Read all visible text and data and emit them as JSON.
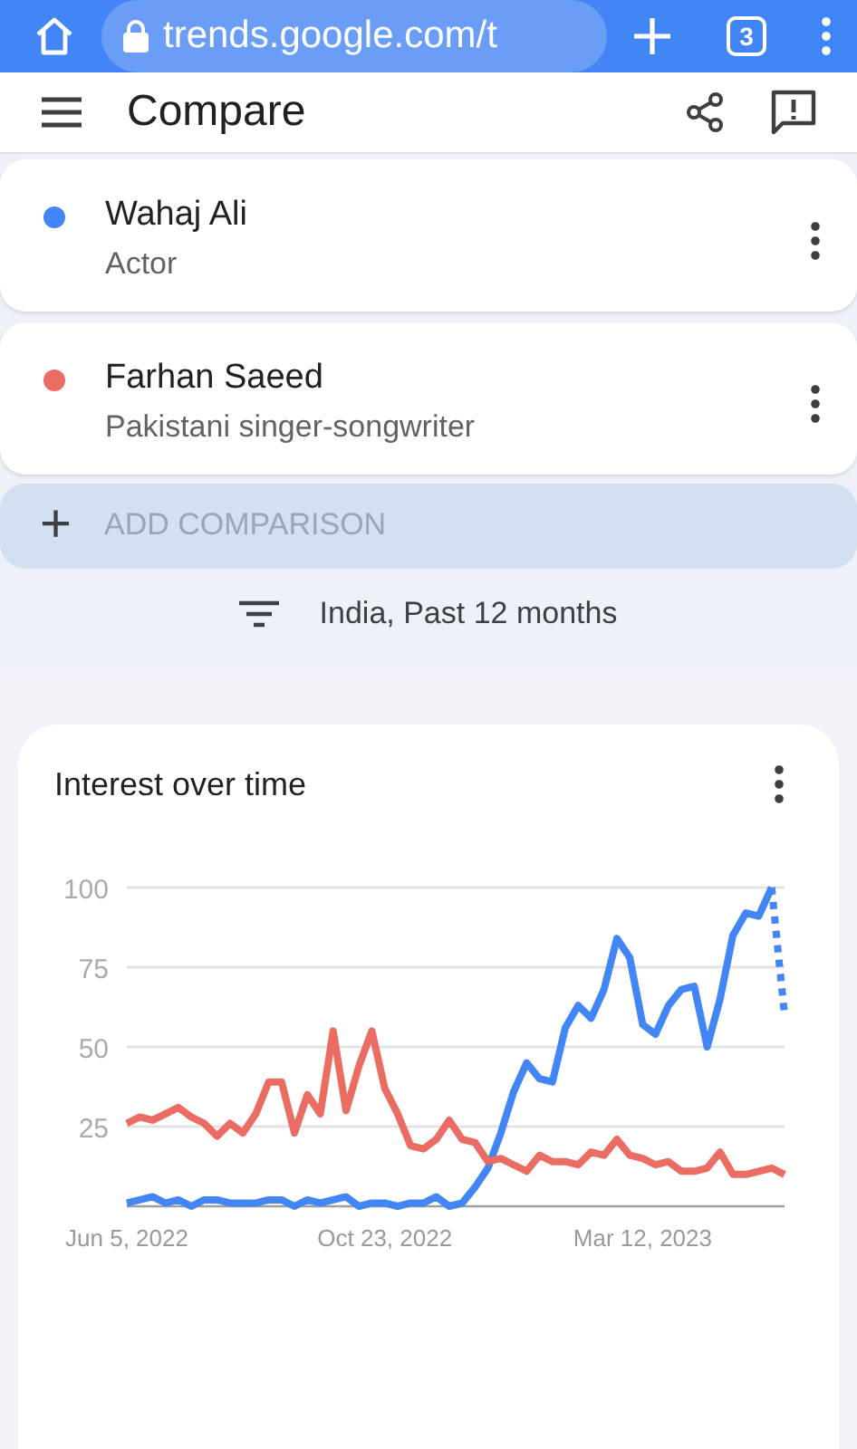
{
  "browser": {
    "url": "trends.google.com/t",
    "tab_count": "3"
  },
  "header": {
    "title": "Compare"
  },
  "terms": [
    {
      "name": "Wahaj Ali",
      "description": "Actor",
      "color": "#4285f4"
    },
    {
      "name": "Farhan Saeed",
      "description": "Pakistani singer-songwriter",
      "color": "#ea6c62"
    }
  ],
  "add_comparison": {
    "icon": "+",
    "label": "ADD COMPARISON"
  },
  "filter": {
    "label": "India, Past 12 months"
  },
  "interest_card": {
    "title": "Interest over time",
    "chart_data": {
      "type": "line",
      "categories": [
        "Jun 5, 2022",
        null,
        null,
        null,
        null,
        null,
        null,
        null,
        null,
        null,
        null,
        null,
        null,
        null,
        null,
        null,
        null,
        null,
        null,
        null,
        "Oct 23, 2022",
        null,
        null,
        null,
        null,
        null,
        null,
        null,
        null,
        null,
        null,
        null,
        null,
        null,
        null,
        null,
        null,
        null,
        null,
        null,
        "Mar 12, 2023",
        null,
        null,
        null,
        null,
        null,
        null,
        null,
        null,
        null,
        null,
        null
      ],
      "series": [
        {
          "color": "#4285f4",
          "values": [
            1,
            2,
            3,
            1,
            2,
            0,
            2,
            2,
            1,
            1,
            1,
            2,
            2,
            0,
            2,
            1,
            2,
            3,
            0,
            1,
            1,
            0,
            1,
            1,
            3,
            0,
            1,
            6,
            12,
            23,
            36,
            45,
            40,
            39,
            56,
            63,
            59,
            68,
            84,
            78,
            57,
            54,
            63,
            68,
            69,
            50,
            65,
            85,
            92,
            91,
            100,
            null
          ]
        },
        {
          "color": "#4285f4",
          "line_style": "dotted",
          "values": [
            null,
            null,
            null,
            null,
            null,
            null,
            null,
            null,
            null,
            null,
            null,
            null,
            null,
            null,
            null,
            null,
            null,
            null,
            null,
            null,
            null,
            null,
            null,
            null,
            null,
            null,
            null,
            null,
            null,
            null,
            null,
            null,
            null,
            null,
            null,
            null,
            null,
            null,
            null,
            null,
            null,
            null,
            null,
            null,
            null,
            null,
            null,
            null,
            null,
            null,
            100,
            60
          ]
        },
        {
          "color": "#ea6c62",
          "values": [
            26,
            28,
            27,
            29,
            31,
            28,
            26,
            22,
            26,
            23,
            29,
            39,
            39,
            23,
            35,
            29,
            55,
            30,
            44,
            55,
            37,
            29,
            19,
            18,
            21,
            27,
            21,
            20,
            14,
            15,
            13,
            11,
            16,
            14,
            14,
            13,
            17,
            16,
            21,
            16,
            15,
            13,
            14,
            11,
            11,
            12,
            17,
            10,
            10,
            11,
            12,
            10
          ]
        }
      ],
      "ylim": [
        0,
        100
      ],
      "yticks": [
        25,
        50,
        75,
        100
      ],
      "grid": true
    }
  }
}
